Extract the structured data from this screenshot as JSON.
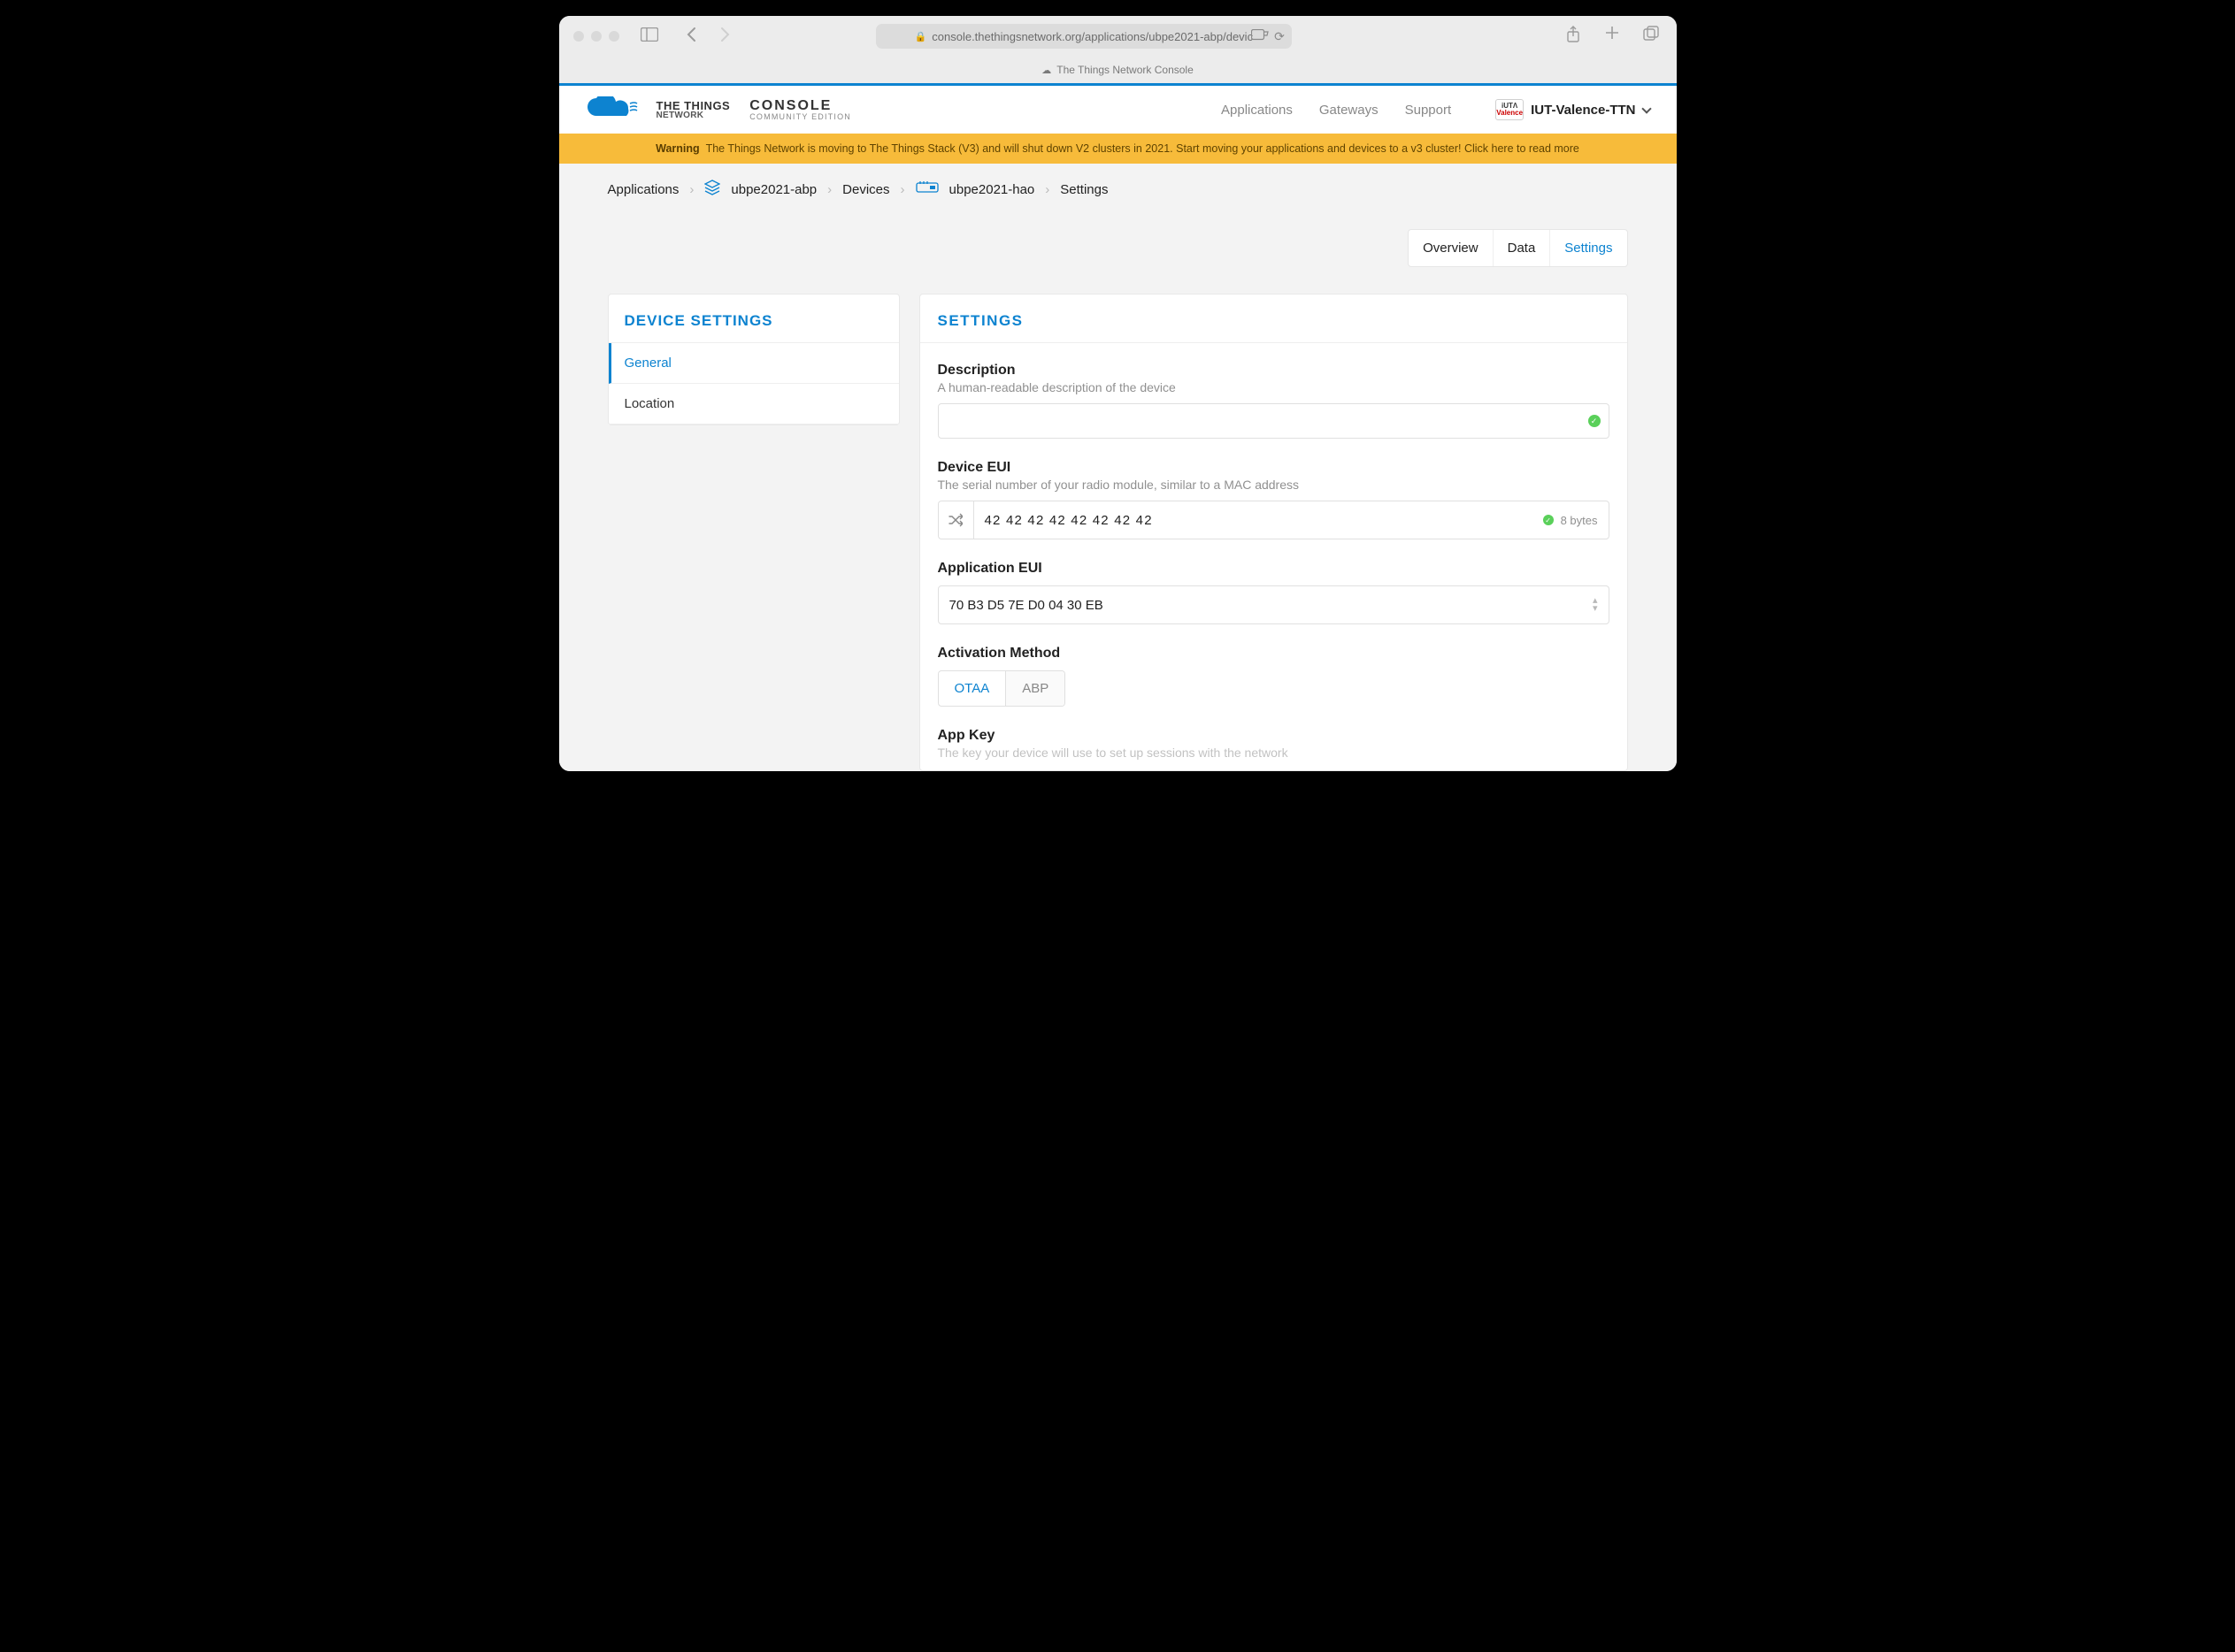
{
  "browser": {
    "url": "console.thethingsnetwork.org/applications/ubpe2021-abp/devic",
    "tab_title": "The Things Network Console"
  },
  "topnav": {
    "brand1_line1": "THE THINGS",
    "brand1_line2": "NETWORK",
    "brand2_line1": "CONSOLE",
    "brand2_line2": "COMMUNITY EDITION",
    "items": [
      "Applications",
      "Gateways",
      "Support"
    ],
    "user": "IUT-Valence-TTN"
  },
  "warning": {
    "label": "Warning",
    "text": "The Things Network is moving to The Things Stack (V3) and will shut down V2 clusters in 2021. Start moving your applications and devices to a v3 cluster! Click here to read more"
  },
  "breadcrumb": [
    "Applications",
    "ubpe2021-abp",
    "Devices",
    "ubpe2021-hao",
    "Settings"
  ],
  "tabs": {
    "items": [
      "Overview",
      "Data",
      "Settings"
    ],
    "active": "Settings"
  },
  "sidebar": {
    "title": "DEVICE SETTINGS",
    "items": [
      "General",
      "Location"
    ],
    "active": "General"
  },
  "panel": {
    "title": "SETTINGS",
    "description": {
      "label": "Description",
      "help": "A human-readable description of the device",
      "value": ""
    },
    "device_eui": {
      "label": "Device EUI",
      "help": "The serial number of your radio module, similar to a MAC address",
      "value": "42 42 42 42 42 42 42 42",
      "bytes": "8 bytes"
    },
    "app_eui": {
      "label": "Application EUI",
      "value": "70 B3 D5 7E D0 04 30 EB"
    },
    "activation": {
      "label": "Activation Method",
      "options": [
        "OTAA",
        "ABP"
      ],
      "active": "OTAA"
    },
    "app_key": {
      "label": "App Key",
      "help": "The key your device will use to set up sessions with the network"
    }
  }
}
